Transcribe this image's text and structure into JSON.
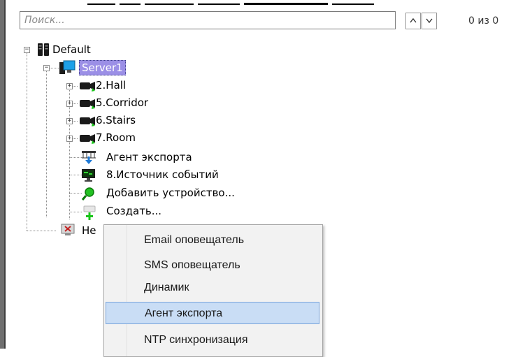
{
  "search": {
    "placeholder": "Поиск...",
    "value": "",
    "result_count": "0 из 0"
  },
  "tree": {
    "root": {
      "label": "Default",
      "icon": "server-rack-icon",
      "expanded": true
    },
    "server": {
      "label": "Server1",
      "icon": "server-monitor-icon",
      "expanded": true,
      "selected": true
    },
    "cameras": [
      {
        "label": "2.Hall",
        "icon": "camera-icon"
      },
      {
        "label": "5.Corridor",
        "icon": "camera-icon"
      },
      {
        "label": "6.Stairs",
        "icon": "camera-icon"
      },
      {
        "label": "7.Room",
        "icon": "camera-icon"
      }
    ],
    "export_agent": {
      "label": "Агент экспорта",
      "icon": "export-agent-icon"
    },
    "event_source": {
      "label": "8.Источник событий",
      "icon": "event-source-icon"
    },
    "add_device": {
      "label": "Добавить устройство...",
      "icon": "search-add-icon"
    },
    "create": {
      "label": "Создать...",
      "icon": "create-plus-icon"
    },
    "partial_item": {
      "label": "Не",
      "icon": "monitor-x-icon"
    }
  },
  "context_menu": {
    "items": [
      {
        "label": "Email оповещатель",
        "highlighted": false
      },
      {
        "label": "SMS оповещатель",
        "highlighted": false
      },
      {
        "label": "Динамик",
        "highlighted": false
      },
      {
        "label": "Агент экспорта",
        "highlighted": true
      },
      {
        "label": "NTP синхронизация",
        "highlighted": false
      }
    ]
  },
  "colors": {
    "selection": "#9b8fe6",
    "menu_highlight": "#c9ddf5",
    "menu_highlight_border": "#78a4dc",
    "menu_background": "#f2f2f2"
  }
}
